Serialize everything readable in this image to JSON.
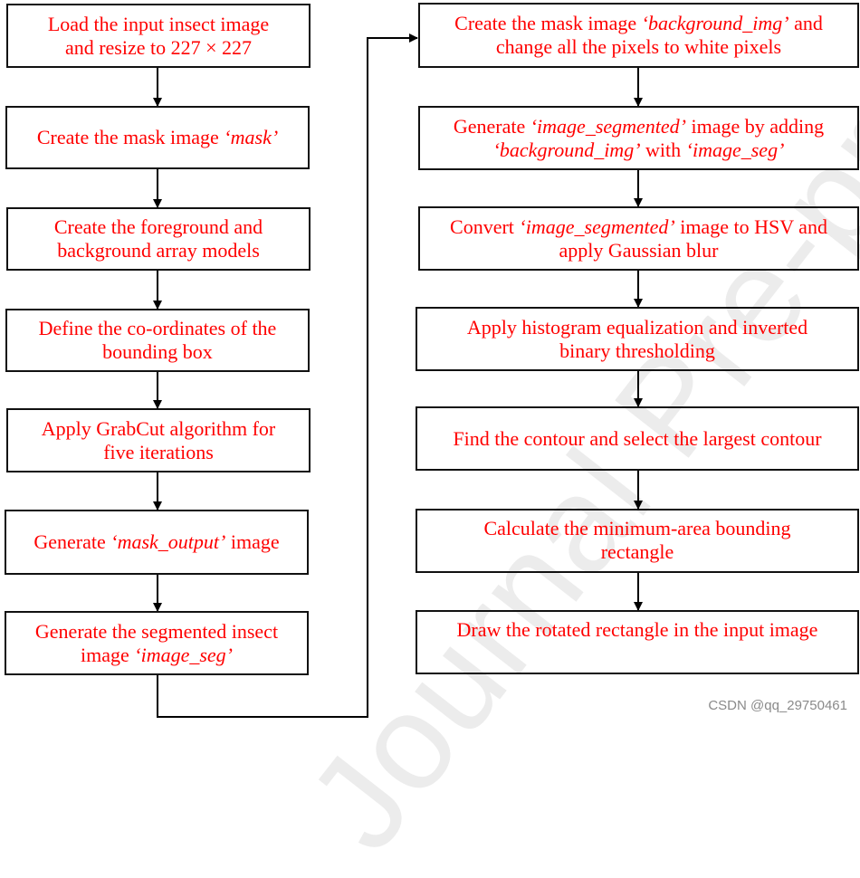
{
  "watermark": "Journal Pre-proofs",
  "credit": "CSDN @qq_29750461",
  "colors": {
    "step_text": "#ff0000",
    "box_border": "#111111",
    "connector": "#000000",
    "watermark": "#ececec",
    "credit": "#8a8a8a"
  },
  "left_column": [
    {
      "id": "L1",
      "parts": [
        {
          "t": "Load the input insect image"
        },
        {
          "br": true
        },
        {
          "t": "and resize to 227 × 227"
        }
      ]
    },
    {
      "id": "L2",
      "parts": [
        {
          "t": "Create the mask image "
        },
        {
          "t": "‘mask’",
          "i": true
        }
      ]
    },
    {
      "id": "L3",
      "parts": [
        {
          "t": "Create the foreground and"
        },
        {
          "br": true
        },
        {
          "t": "background array models"
        }
      ]
    },
    {
      "id": "L4",
      "parts": [
        {
          "t": "Define the co-ordinates of the"
        },
        {
          "br": true
        },
        {
          "t": "bounding box"
        }
      ]
    },
    {
      "id": "L5",
      "parts": [
        {
          "t": "Apply GrabCut algorithm for"
        },
        {
          "br": true
        },
        {
          "t": "five iterations"
        }
      ]
    },
    {
      "id": "L6",
      "parts": [
        {
          "t": "Generate "
        },
        {
          "t": "‘mask_output’",
          "i": true
        },
        {
          "t": " image"
        }
      ]
    },
    {
      "id": "L7",
      "parts": [
        {
          "t": "Generate the segmented insect"
        },
        {
          "br": true
        },
        {
          "t": "image "
        },
        {
          "t": "‘image_seg’",
          "i": true
        }
      ]
    }
  ],
  "right_column": [
    {
      "id": "R1",
      "parts": [
        {
          "t": "Create the mask image "
        },
        {
          "t": "‘background_img’",
          "i": true
        },
        {
          "t": " and"
        },
        {
          "br": true
        },
        {
          "t": "change  all the pixels to white pixels"
        }
      ]
    },
    {
      "id": "R2",
      "parts": [
        {
          "t": "Generate "
        },
        {
          "t": "‘image_segmented’",
          "i": true
        },
        {
          "t": " image by adding"
        },
        {
          "br": true
        },
        {
          "t": "‘background_img’",
          "i": true
        },
        {
          "t": " with "
        },
        {
          "t": "‘image_seg’",
          "i": true
        }
      ]
    },
    {
      "id": "R3",
      "parts": [
        {
          "t": "Convert "
        },
        {
          "t": "‘image_segmented’",
          "i": true
        },
        {
          "t": " image to HSV and"
        },
        {
          "br": true
        },
        {
          "t": "apply Gaussian blur"
        }
      ]
    },
    {
      "id": "R4",
      "parts": [
        {
          "t": "Apply histogram equalization and inverted"
        },
        {
          "br": true
        },
        {
          "t": "binary thresholding"
        }
      ]
    },
    {
      "id": "R5",
      "parts": [
        {
          "t": "Find the contour and select the largest contour"
        }
      ]
    },
    {
      "id": "R6",
      "parts": [
        {
          "t": "Calculate the minimum-area bounding"
        },
        {
          "br": true
        },
        {
          "t": "rectangle"
        }
      ]
    },
    {
      "id": "R7",
      "parts": [
        {
          "t": "Draw the rotated rectangle in the input image"
        }
      ]
    }
  ],
  "flow": [
    [
      "L1",
      "L2"
    ],
    [
      "L2",
      "L3"
    ],
    [
      "L3",
      "L4"
    ],
    [
      "L4",
      "L5"
    ],
    [
      "L5",
      "L6"
    ],
    [
      "L6",
      "L7"
    ],
    [
      "L7",
      "R1"
    ],
    [
      "R1",
      "R2"
    ],
    [
      "R2",
      "R3"
    ],
    [
      "R3",
      "R4"
    ],
    [
      "R4",
      "R5"
    ],
    [
      "R5",
      "R6"
    ],
    [
      "R6",
      "R7"
    ]
  ]
}
